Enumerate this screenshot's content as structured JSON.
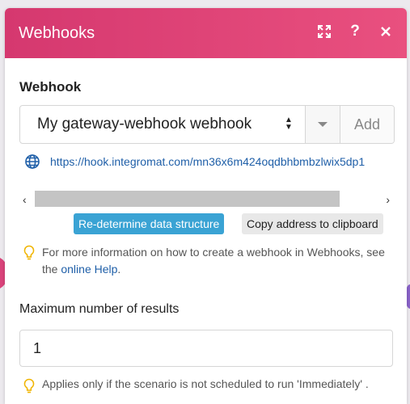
{
  "panel": {
    "title": "Webhooks",
    "header_icons": [
      "expand-icon",
      "help-icon",
      "close-icon"
    ],
    "accent_color": "#e0467a"
  },
  "webhook": {
    "label": "Webhook",
    "selected": "My gateway-webhook webhook",
    "add_label": "Add",
    "url": "https://hook.integromat.com/mn36x6m424oqdbhbmbzlwix5dp1"
  },
  "buttons": {
    "redetermine": "Re-determine data structure",
    "copy": "Copy address to clipboard"
  },
  "info": {
    "text_before": "For more information on how to create a webhook in Webhooks, see the ",
    "link": "online Help",
    "text_after": "."
  },
  "max_results": {
    "label": "Maximum number of results",
    "value": "1",
    "hint": "Applies only if the scenario is not scheduled to run 'Immediately' ."
  }
}
